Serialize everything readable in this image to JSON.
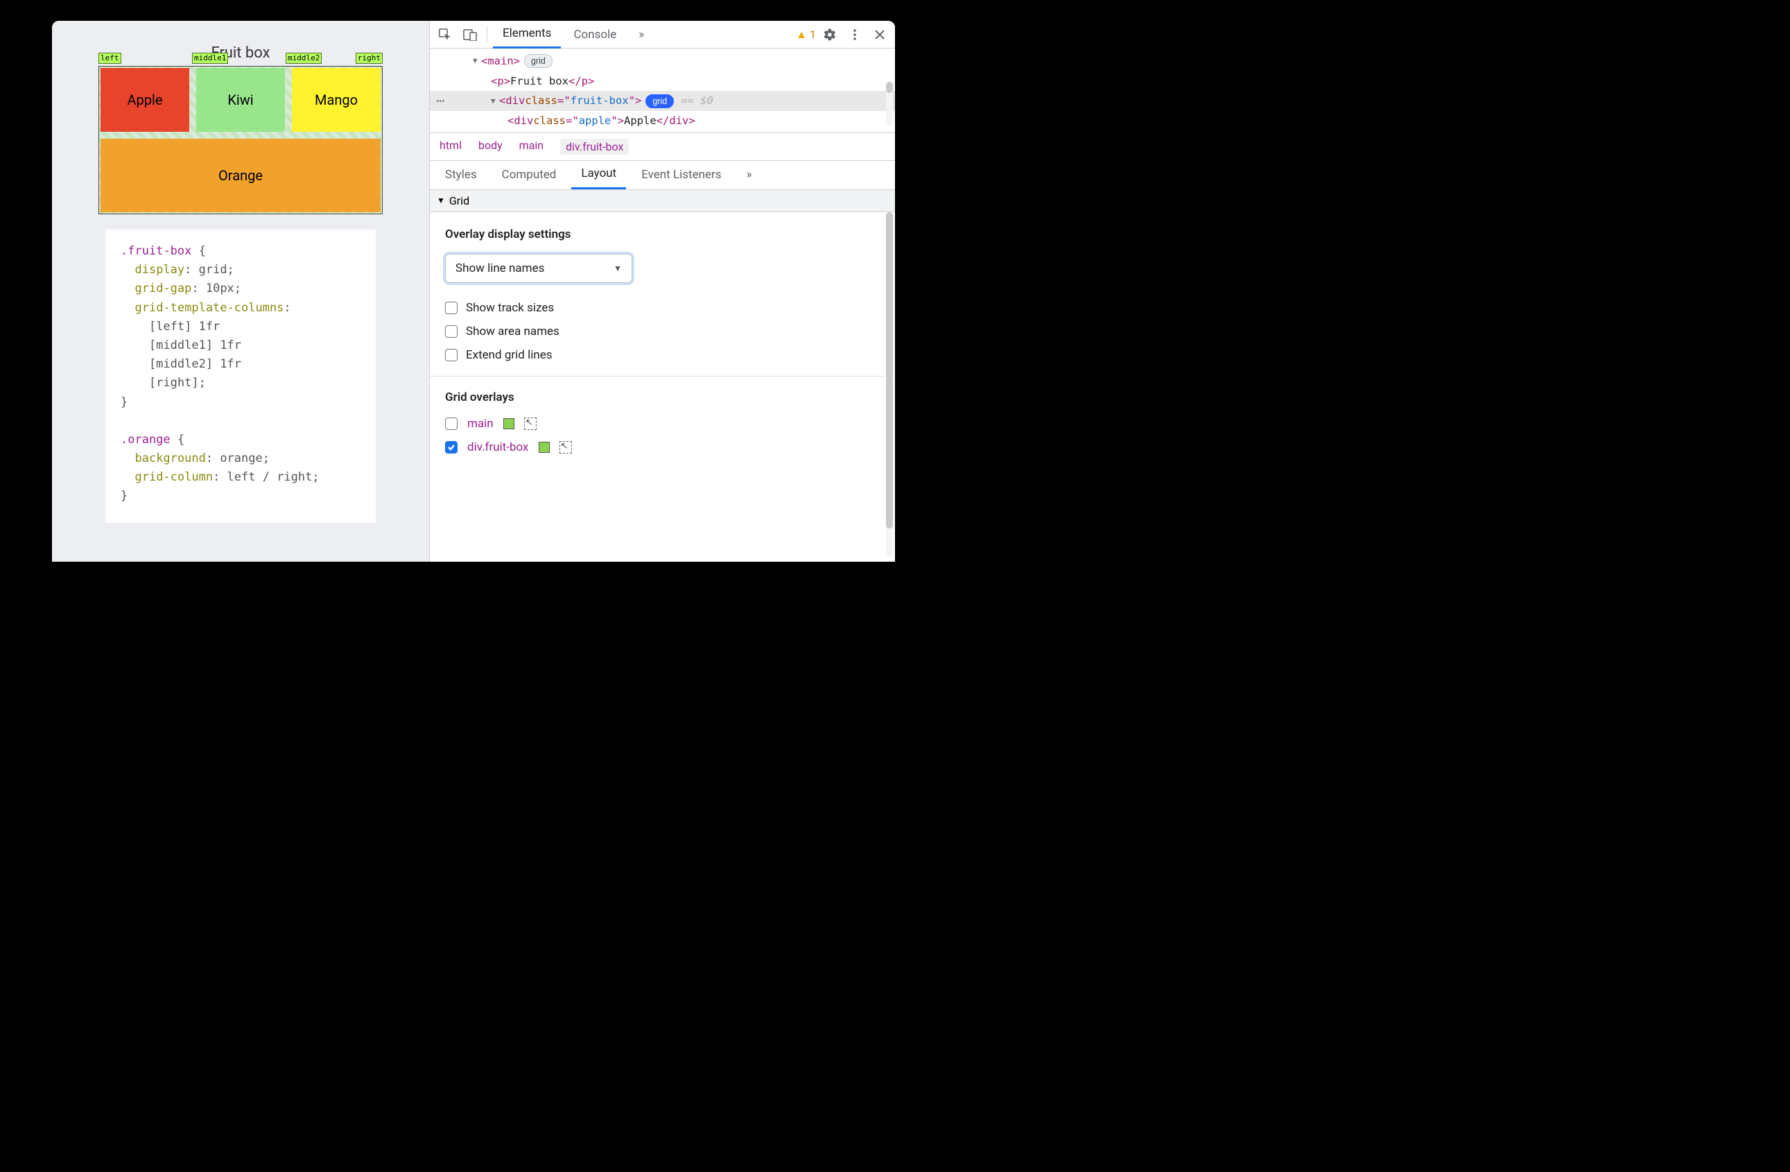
{
  "page": {
    "title": "Fruit box",
    "line_names": {
      "left": "left",
      "m1": "middle1",
      "m2": "middle2",
      "right": "right"
    },
    "cells": {
      "apple": "Apple",
      "kiwi": "Kiwi",
      "mango": "Mango",
      "orange": "Orange"
    },
    "css": ".fruit-box {\n  display: grid;\n  grid-gap: 10px;\n  grid-template-columns:\n    [left] 1fr\n    [middle1] 1fr\n    [middle2] 1fr\n    [right];\n}\n\n.orange {\n  background: orange;\n  grid-column: left / right;\n}"
  },
  "devtools": {
    "tabs": {
      "elements": "Elements",
      "console": "Console"
    },
    "more": "»",
    "warning_count": "1",
    "dom": {
      "main_tag": "main",
      "main_badge": "grid",
      "p_tag": "p",
      "p_text": "Fruit box",
      "div_tag": "div",
      "class_attr": "class",
      "fruit_box_class": "fruit-box",
      "grid_badge": "grid",
      "eq0": "== $0",
      "apple_class": "apple",
      "apple_text": "Apple"
    },
    "breadcrumbs": [
      "html",
      "body",
      "main",
      "div.fruit-box"
    ],
    "panel_tabs": {
      "styles": "Styles",
      "computed": "Computed",
      "layout": "Layout",
      "events": "Event Listeners"
    },
    "grid_section_title": "Grid",
    "overlay": {
      "title": "Overlay display settings",
      "select": "Show line names",
      "show_track_sizes": "Show track sizes",
      "show_area_names": "Show area names",
      "extend_grid_lines": "Extend grid lines"
    },
    "grid_overlays": {
      "title": "Grid overlays",
      "main": "main",
      "main_checked": false,
      "fruit_box": "div.fruit-box",
      "fruit_box_checked": true
    }
  }
}
